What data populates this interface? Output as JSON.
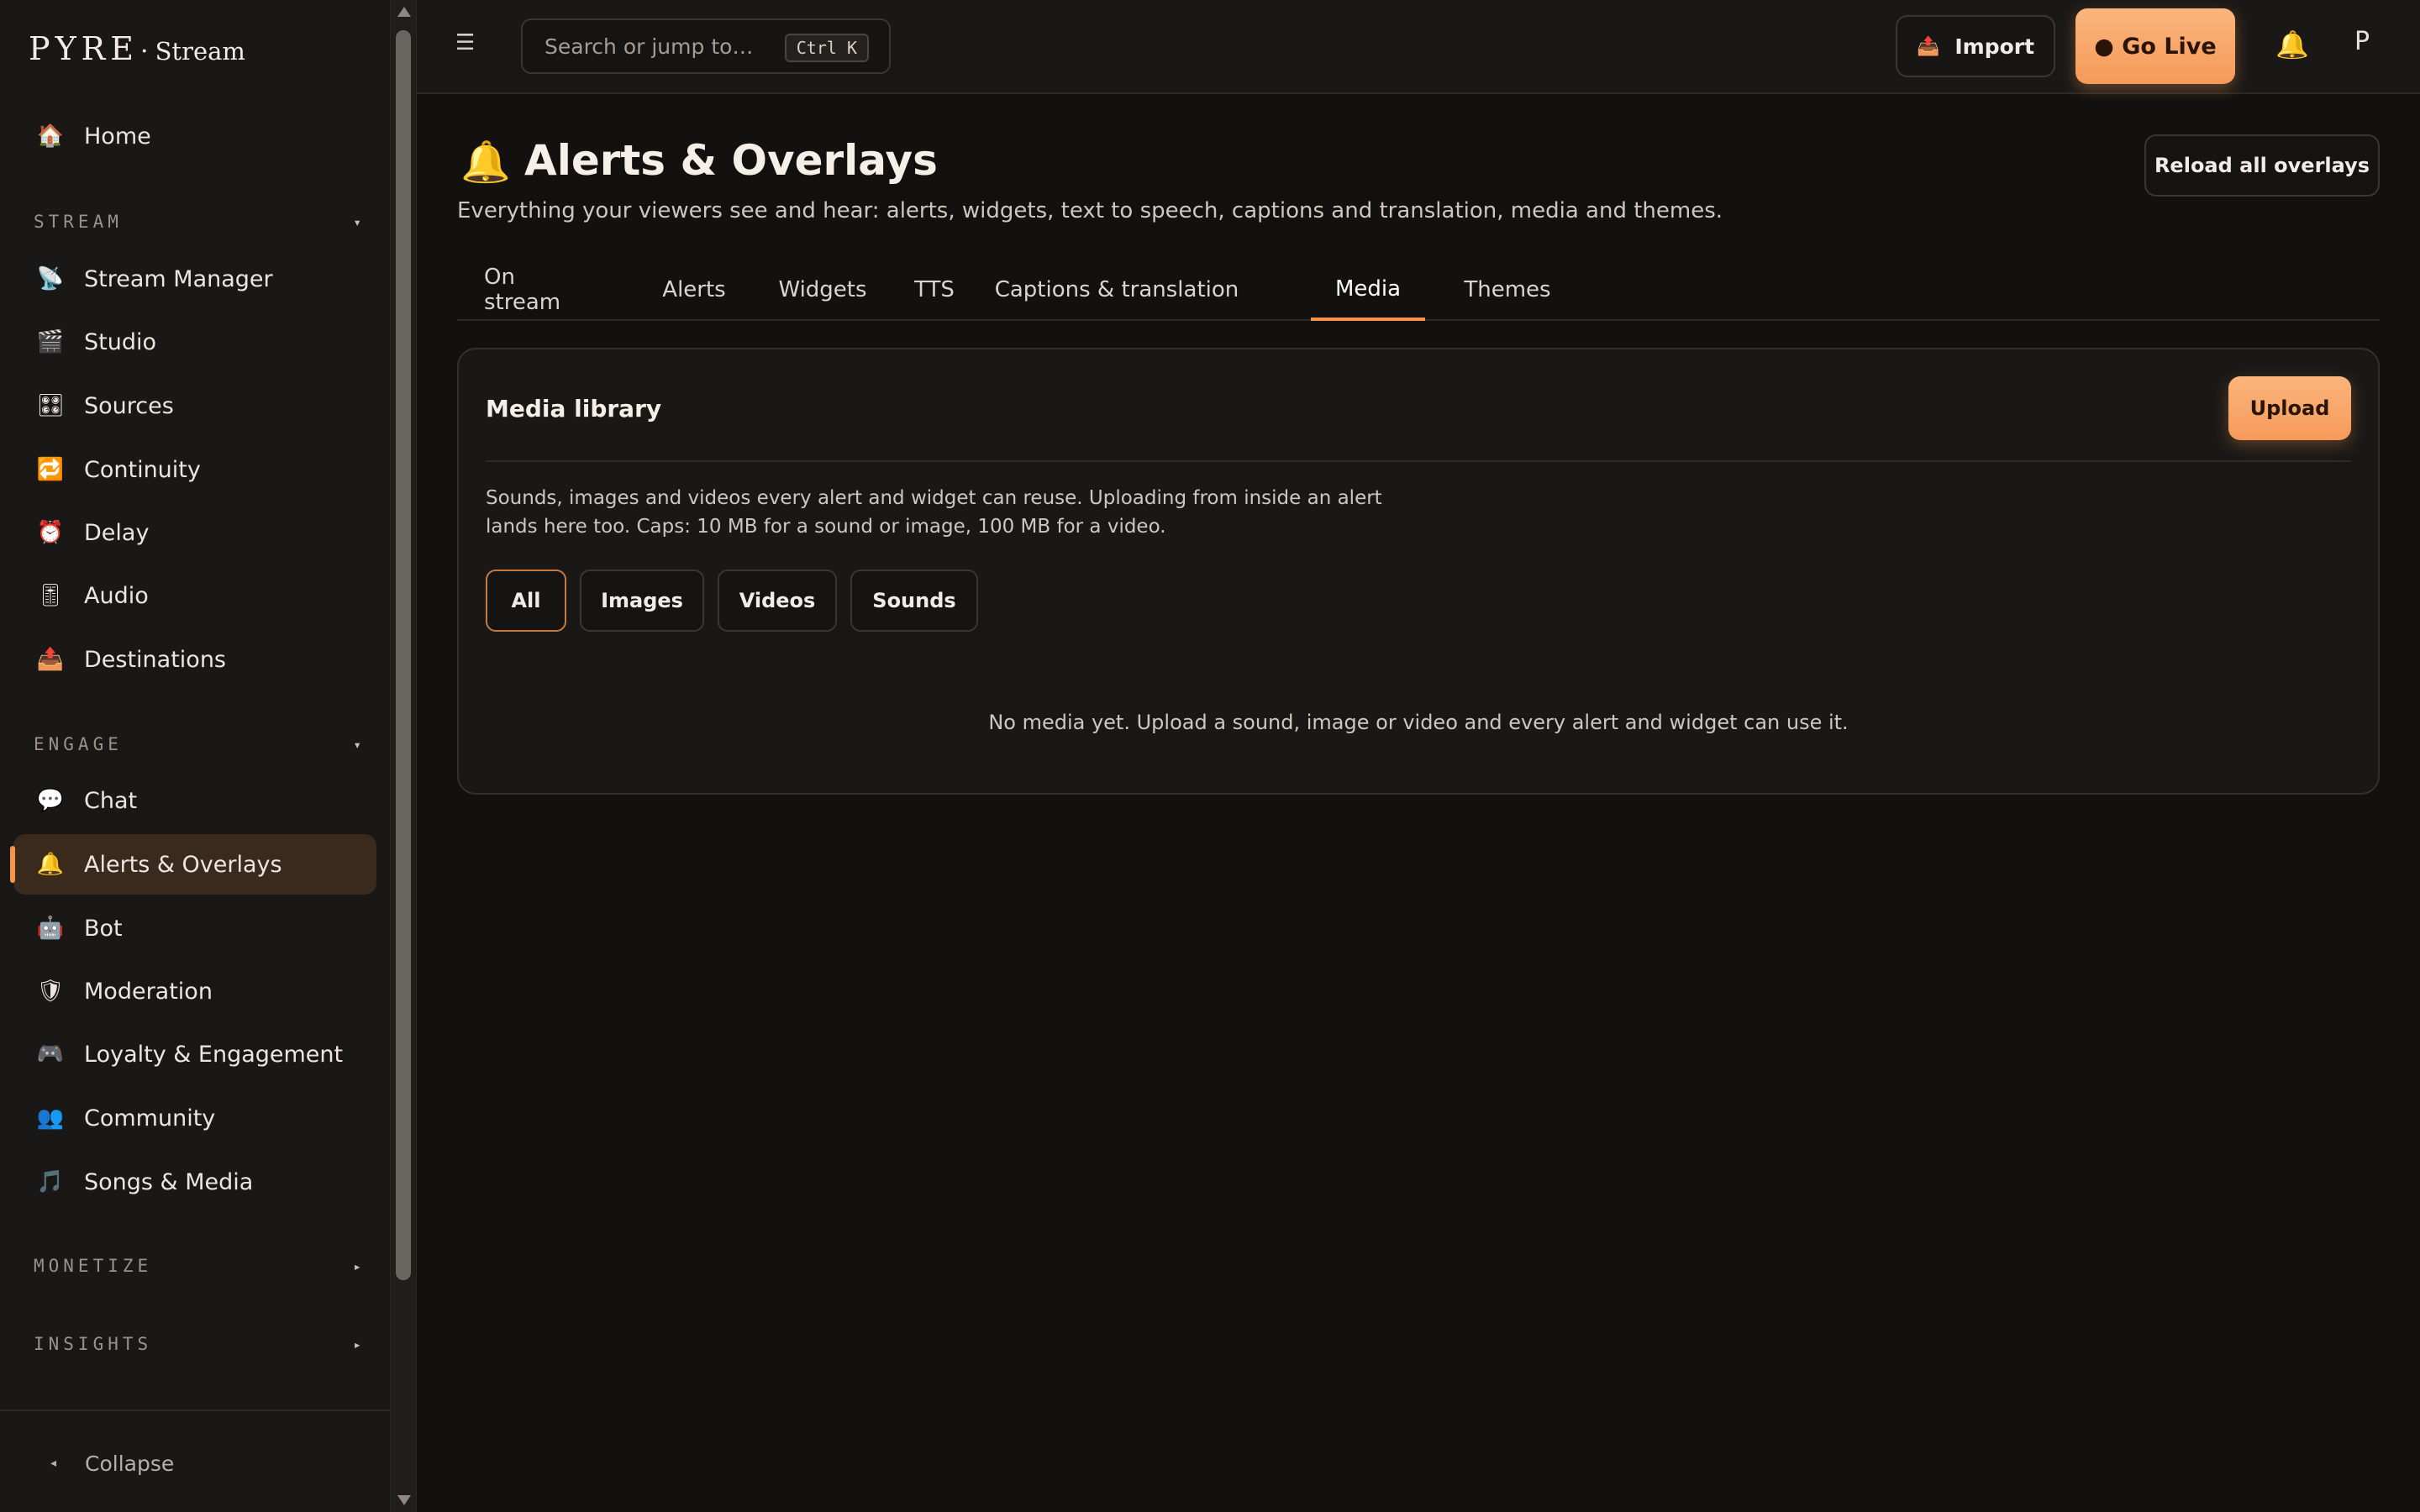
{
  "app": {
    "brand": "PYRE",
    "brand_separator": "·",
    "brand_sub": "Stream"
  },
  "sidebar": {
    "home": {
      "label": "Home",
      "icon": "house-icon"
    },
    "sections": {
      "stream": "STREAM",
      "engage": "ENGAGE",
      "monetize": "MONETIZE",
      "insights": "INSIGHTS"
    },
    "stream_items": [
      {
        "label": "Stream Manager",
        "icon": "satellite-dish-icon"
      },
      {
        "label": "Studio",
        "icon": "clapperboard-icon"
      },
      {
        "label": "Sources",
        "icon": "control-knobs-icon"
      },
      {
        "label": "Continuity",
        "icon": "repeat-icon"
      },
      {
        "label": "Delay",
        "icon": "alarm-clock-icon"
      },
      {
        "label": "Audio",
        "icon": "level-slider-icon"
      },
      {
        "label": "Destinations",
        "icon": "outbox-tray-icon"
      }
    ],
    "engage_items": [
      {
        "label": "Chat",
        "icon": "speech-bubble-icon"
      },
      {
        "label": "Alerts & Overlays",
        "icon": "bell-icon",
        "active": true
      },
      {
        "label": "Bot",
        "icon": "robot-icon"
      },
      {
        "label": "Moderation",
        "icon": "shield-icon"
      },
      {
        "label": "Loyalty & Engagement",
        "icon": "gamepad-icon"
      },
      {
        "label": "Community",
        "icon": "people-icon"
      },
      {
        "label": "Songs & Media",
        "icon": "music-note-icon"
      }
    ],
    "collapse_label": "Collapse"
  },
  "topbar": {
    "search_placeholder": "Search or jump to…",
    "shortcut": "Ctrl K",
    "import_label": "Import",
    "go_live_label": "● Go Live",
    "avatar_initial": "P"
  },
  "page": {
    "title": "Alerts & Overlays",
    "subtitle": "Everything your viewers see and hear: alerts, widgets, text to speech, captions and translation, media and themes.",
    "reload_label": "Reload all overlays",
    "tabs": [
      "On stream",
      "Alerts",
      "Widgets",
      "TTS",
      "Captions & translation",
      "Media",
      "Themes"
    ],
    "active_tab": "Media"
  },
  "media": {
    "title": "Media library",
    "upload_label": "Upload",
    "description": "Sounds, images and videos every alert and widget can reuse. Uploading from inside an alert lands here too. Caps: 10 MB for a sound or image, 100 MB for a video.",
    "filters": [
      "All",
      "Images",
      "Videos",
      "Sounds"
    ],
    "active_filter": "All",
    "empty_text": "No media yet. Upload a sound, image or video and every alert and widget can use it."
  },
  "colors": {
    "accent": "#f4944a",
    "background": "#121110",
    "panel": "#1a1817"
  }
}
